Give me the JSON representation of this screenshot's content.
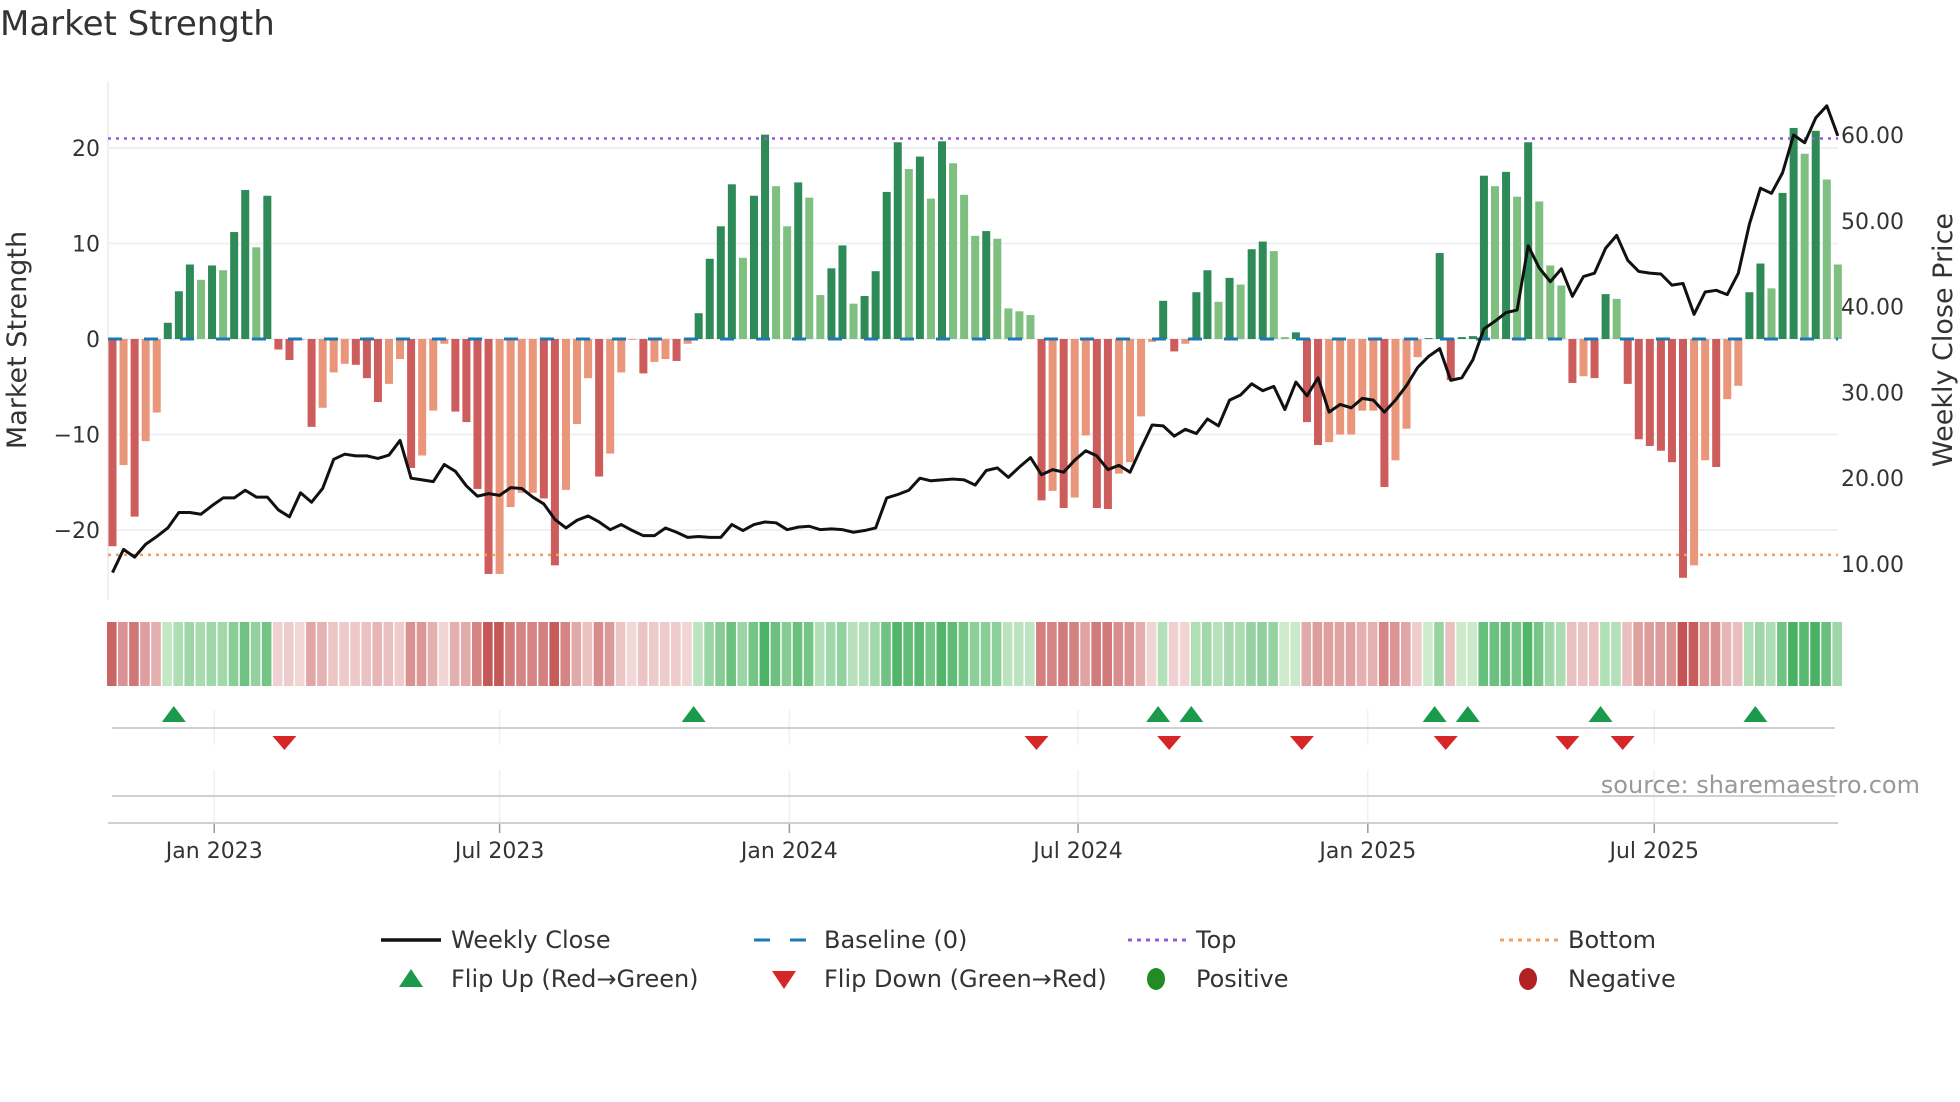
{
  "title": "Market Strength",
  "source": "source: sharemaestro.com",
  "chart_data": {
    "type": "bar",
    "title": "Market Strength",
    "ylabel": "Market Strength",
    "y2label": "Weekly Close Price",
    "ylim": [
      -27,
      26
    ],
    "y2lim": [
      5,
      66
    ],
    "yticks": [
      20,
      10,
      0,
      -10,
      -20
    ],
    "ytick_labels": [
      "20",
      "10",
      "0",
      "−10",
      "−20"
    ],
    "y2ticks": [
      60,
      50,
      40,
      30,
      20,
      10
    ],
    "y2tick_labels": [
      "60.00",
      "50.00",
      "40.00",
      "30.00",
      "20.00",
      "10.00"
    ],
    "xtick_labels": [
      "Jan 2023",
      "Jul 2023",
      "Jan 2024",
      "Jul 2024",
      "Jan 2025",
      "Jul 2025"
    ],
    "xtick_bar_index": [
      9.2,
      35,
      61.2,
      87.3,
      113.5,
      139.4
    ],
    "top": 21,
    "bottom": -22.6,
    "strength": [
      -21.7,
      -13.2,
      -18.6,
      -10.7,
      -7.7,
      1.7,
      5,
      7.8,
      6.2,
      7.7,
      7.2,
      11.2,
      15.6,
      9.6,
      15,
      -1.1,
      -2.2,
      -0.1,
      -9.2,
      -7.2,
      -3.5,
      -2.6,
      -2.7,
      -4.1,
      -6.6,
      -4.7,
      -2.1,
      -13.5,
      -12.2,
      -7.5,
      -0.5,
      -7.6,
      -8.7,
      -15.7,
      -24.6,
      -24.6,
      -17.6,
      -16.1,
      -16.1,
      -16.7,
      -23.7,
      -15.8,
      -8.9,
      -4.1,
      -14.4,
      -12,
      -3.5,
      -0.05,
      -3.6,
      -2.4,
      -2.1,
      -2.3,
      -0.5,
      2.7,
      8.4,
      11.8,
      16.2,
      8.5,
      15,
      21.4,
      16,
      11.8,
      16.4,
      14.8,
      4.6,
      7.4,
      9.8,
      3.7,
      4.5,
      7.1,
      15.4,
      20.6,
      17.8,
      19.1,
      14.7,
      20.7,
      18.4,
      15.1,
      10.8,
      11.3,
      10.5,
      3.2,
      2.9,
      2.5,
      -16.9,
      -15.9,
      -17.7,
      -16.6,
      -10.1,
      -17.7,
      -17.8,
      -14.1,
      -12.9,
      -8.1,
      -0.3,
      4,
      -1.3,
      -0.5,
      4.9,
      7.2,
      3.9,
      6.4,
      5.7,
      9.4,
      10.2,
      9.2,
      0.2,
      0.7,
      -8.7,
      -11.1,
      -10.8,
      -10,
      -10,
      -7.5,
      -7.5,
      -15.5,
      -12.7,
      -9.4,
      -1.9,
      0.1,
      9,
      -4.3,
      0.2,
      0.3,
      17.1,
      16,
      17.5,
      14.9,
      20.6,
      14.4,
      7.7,
      5.6,
      -4.6,
      -3.9,
      -4.1,
      4.7,
      4.2,
      -4.7,
      -10.5,
      -11.2,
      -11.7,
      -12.9,
      -25,
      -23.7,
      -12.7,
      -13.4,
      -6.3,
      -4.9,
      4.9,
      7.9,
      5.3,
      15.3,
      22.1,
      19.4,
      21.8,
      16.7,
      7.8
    ],
    "weekly_close": [
      9,
      11.7,
      10.8,
      12.3,
      13.2,
      14.2,
      16,
      16,
      15.8,
      16.8,
      17.7,
      17.7,
      18.6,
      17.8,
      17.8,
      16.3,
      15.5,
      18.3,
      17.2,
      18.8,
      22.2,
      22.8,
      22.6,
      22.6,
      22.3,
      22.7,
      24.4,
      20,
      19.8,
      19.6,
      21.6,
      20.8,
      19.1,
      17.9,
      18.2,
      18,
      18.9,
      18.8,
      17.8,
      17,
      15.2,
      14.2,
      15.1,
      15.6,
      14.9,
      14,
      14.6,
      13.9,
      13.3,
      13.3,
      14.2,
      13.7,
      13.1,
      13.2,
      13.1,
      13.1,
      14.6,
      13.9,
      14.6,
      14.9,
      14.8,
      14,
      14.3,
      14.4,
      14,
      14.1,
      14,
      13.7,
      13.9,
      14.2,
      17.7,
      18.1,
      18.6,
      20,
      19.7,
      19.8,
      19.9,
      19.8,
      19.2,
      20.9,
      21.2,
      20.1,
      21.3,
      22.4,
      20.4,
      21,
      20.7,
      22.1,
      23.2,
      22.6,
      21,
      21.5,
      20.7,
      23.5,
      26.2,
      26.1,
      24.9,
      25.7,
      25.2,
      26.9,
      26.1,
      29.1,
      29.7,
      31,
      30.2,
      30.7,
      28,
      31.2,
      29.6,
      31.7,
      27.7,
      28.6,
      28.2,
      29.3,
      29.1,
      27.7,
      29.1,
      30.8,
      32.9,
      34.2,
      35.1,
      31.4,
      31.7,
      33.8,
      37.4,
      38.3,
      39.3,
      39.6,
      47.1,
      44.5,
      42.9,
      44.4,
      41.2,
      43.5,
      43.9,
      46.8,
      48.3,
      45.4,
      44.1,
      43.9,
      43.8,
      42.5,
      42.7,
      39.1,
      41.7,
      41.9,
      41.4,
      43.9,
      49.6,
      53.8,
      53.2,
      55.6,
      60,
      59.1,
      62,
      63.4,
      59.9
    ],
    "flip_up_index": [
      5,
      52,
      94,
      97,
      119,
      122,
      134,
      148
    ],
    "flip_down_index": [
      15,
      83,
      95,
      107,
      120,
      131,
      136
    ],
    "legend": [
      {
        "label": "Weekly Close",
        "kind": "line",
        "color": "#111111"
      },
      {
        "label": "Baseline (0)",
        "kind": "dash",
        "color": "#1f77b4"
      },
      {
        "label": "Top",
        "kind": "dot",
        "color": "#9b59d6"
      },
      {
        "label": "Bottom",
        "kind": "dot",
        "color": "#f0a060"
      },
      {
        "label": "Flip Up (Red→Green)",
        "kind": "tri-up",
        "color": "#1a9a4a"
      },
      {
        "label": "Flip Down (Green→Red)",
        "kind": "tri-down",
        "color": "#d62728"
      },
      {
        "label": "Positive",
        "kind": "dot-marker",
        "color": "#228b22"
      },
      {
        "label": "Negative",
        "kind": "dot-marker",
        "color": "#b22222"
      }
    ],
    "legend_placement": "bottom",
    "colors": {
      "pos_strong": "#2e8b57",
      "pos_weak": "#7fbf7f",
      "neg_strong": "#cd5c5c",
      "neg_weak": "#e9967a",
      "baseline": "#1f77b4",
      "top": "#9b59d6",
      "bottom": "#f0a060"
    }
  }
}
